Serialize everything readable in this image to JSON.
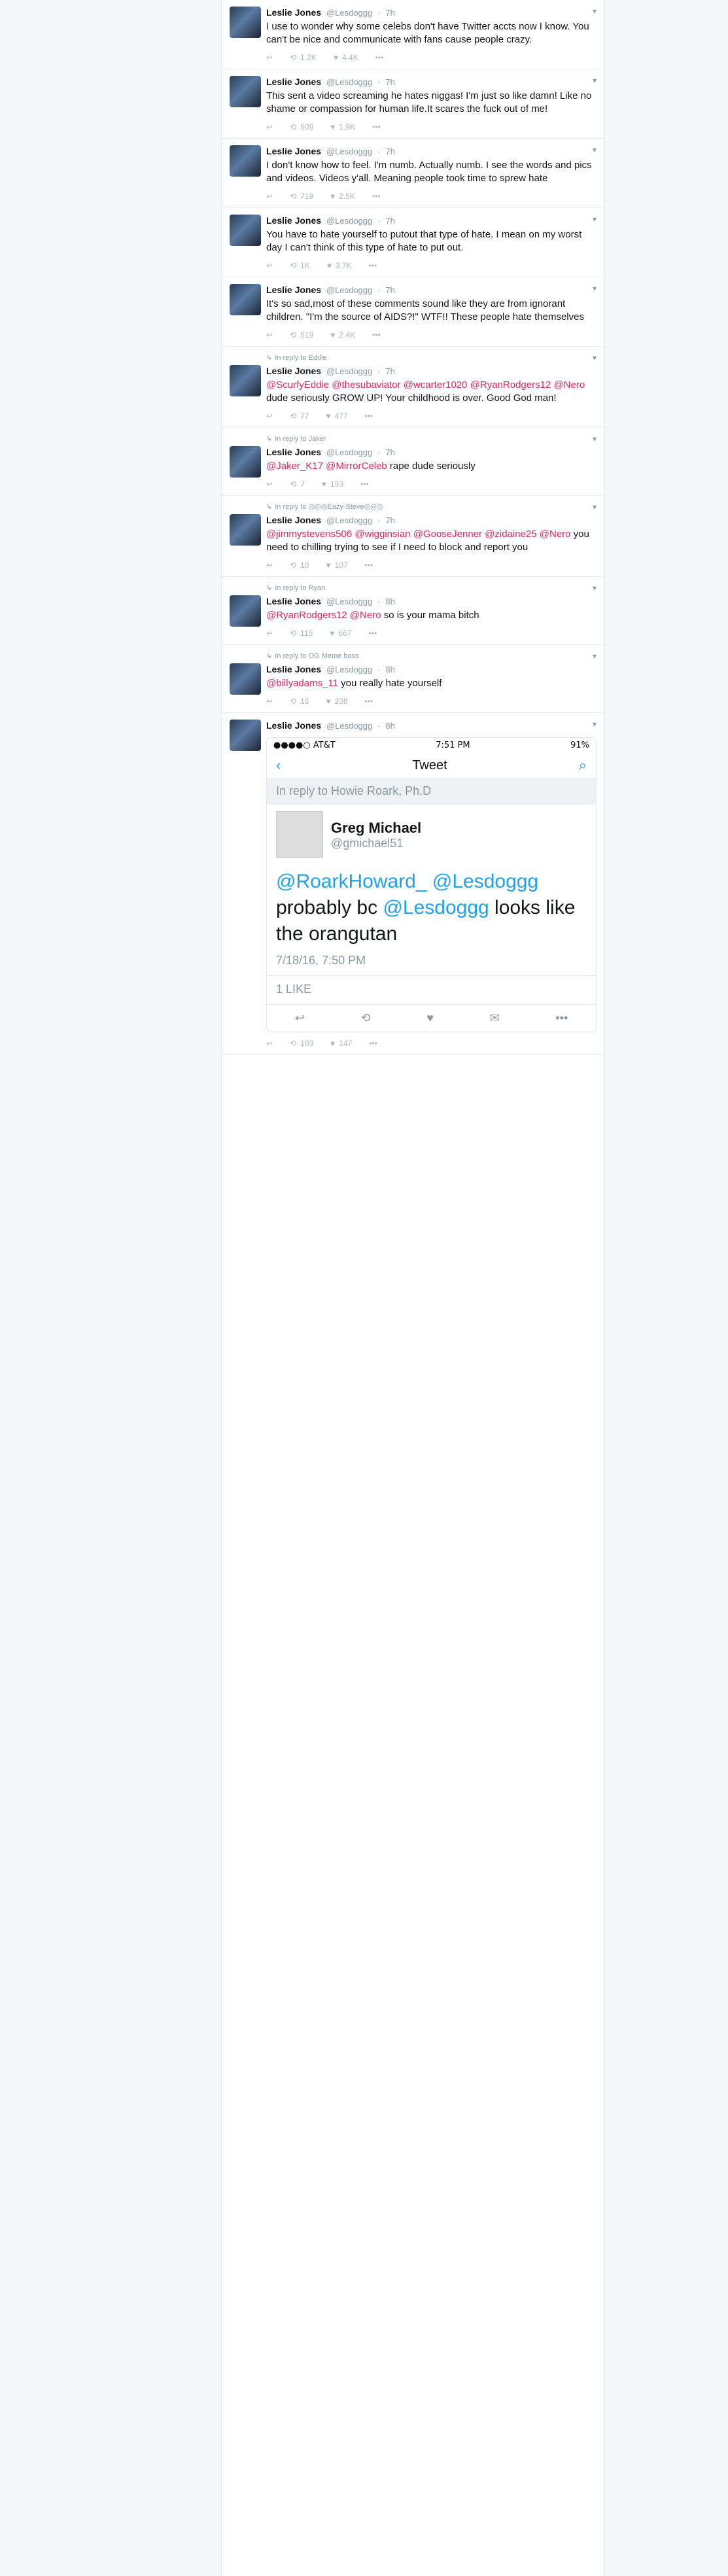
{
  "tweets": [
    {
      "ctx": "",
      "name": "Leslie Jones",
      "handle": "@Lesdoggg",
      "time": "7h",
      "text": "I use to wonder why some celebs don't have Twitter accts now I know. You can't be nice and communicate with fans cause people crazy.",
      "rt": "1.2K",
      "likes": "4.4K"
    },
    {
      "ctx": "",
      "name": "Leslie Jones",
      "handle": "@Lesdoggg",
      "time": "7h",
      "text": "This sent a video screaming he hates niggas! I'm just so like damn! Like no shame or compassion for human life.It scares the fuck out of me!",
      "rt": "509",
      "likes": "1.9K"
    },
    {
      "ctx": "",
      "name": "Leslie Jones",
      "handle": "@Lesdoggg",
      "time": "7h",
      "text": "I don't know how to feel. I'm numb. Actually numb. I see the words and pics and videos. Videos y'all. Meaning people took time to sprew hate",
      "rt": "719",
      "likes": "2.5K"
    },
    {
      "ctx": "",
      "name": "Leslie Jones",
      "handle": "@Lesdoggg",
      "time": "7h",
      "text": "You have to hate yourself to putout that type of hate. I mean on my worst day I can't think of this type of hate to put out.",
      "rt": "1K",
      "likes": "3.7K"
    },
    {
      "ctx": "",
      "name": "Leslie Jones",
      "handle": "@Lesdoggg",
      "time": "7h",
      "text": "It's so sad,most of these comments sound like they are from ignorant children. \"I'm the source of AIDS?!\" WTF!! These people hate themselves",
      "rt": "519",
      "likes": "2.4K"
    },
    {
      "ctx": "In reply to Eddie",
      "name": "Leslie Jones",
      "handle": "@Lesdoggg",
      "time": "7h",
      "mentions": "@ScurfyEddie @thesubaviator @wcarter1020 @RyanRodgers12 @Nero",
      "text": " dude seriously GROW UP! Your childhood is over. Good God man!",
      "rt": "77",
      "likes": "477"
    },
    {
      "ctx": "In reply to Jaker",
      "name": "Leslie Jones",
      "handle": "@Lesdoggg",
      "time": "7h",
      "mentions": "@Jaker_K17 @MirrorCeleb",
      "text": " rape dude seriously",
      "rt": "7",
      "likes": "153"
    },
    {
      "ctx": "In reply to ◎◎◎Eazy-Steve◎◎◎",
      "name": "Leslie Jones",
      "handle": "@Lesdoggg",
      "time": "7h",
      "mentions": "@jimmystevens506 @wigginsian @GooseJenner @zidaine25 @Nero",
      "text": " you need to chilling trying to see if I need to block and report you",
      "rt": "10",
      "likes": "107"
    },
    {
      "ctx": "In reply to Ryan",
      "name": "Leslie Jones",
      "handle": "@Lesdoggg",
      "time": "8h",
      "mentions": "@RyanRodgers12 @Nero",
      "text": " so is your mama bitch",
      "rt": "115",
      "likes": "667"
    },
    {
      "ctx": "In reply to OG Meme boss",
      "name": "Leslie Jones",
      "handle": "@Lesdoggg",
      "time": "8h",
      "mentions": "@billyadams_11",
      "text": " you really hate yourself",
      "rt": "16",
      "likes": "238"
    }
  ],
  "screenshot_tweet": {
    "name": "Leslie Jones",
    "handle": "@Lesdoggg",
    "time": "8h",
    "status_left": "●●●●○ AT&T",
    "status_time": "7:51 PM",
    "status_right": "91%",
    "nav_title": "Tweet",
    "reply_to": "In reply to Howie Roark, Ph.D",
    "quoted_name": "Greg Michael",
    "quoted_handle": "@gmichael51",
    "quoted_text_a": "@RoarkHoward_ @Lesdoggg",
    "quoted_text_b": " probably bc ",
    "quoted_text_c": "@Lesdoggg",
    "quoted_text_d": " looks like the orangutan",
    "quoted_time": "7/18/16, 7:50 PM",
    "quoted_likes": "1 LIKE",
    "rt": "103",
    "likes": "147"
  },
  "icons": [
    "reply-icon",
    "retweet-icon",
    "like-icon",
    "more-icon",
    "caret-icon"
  ]
}
